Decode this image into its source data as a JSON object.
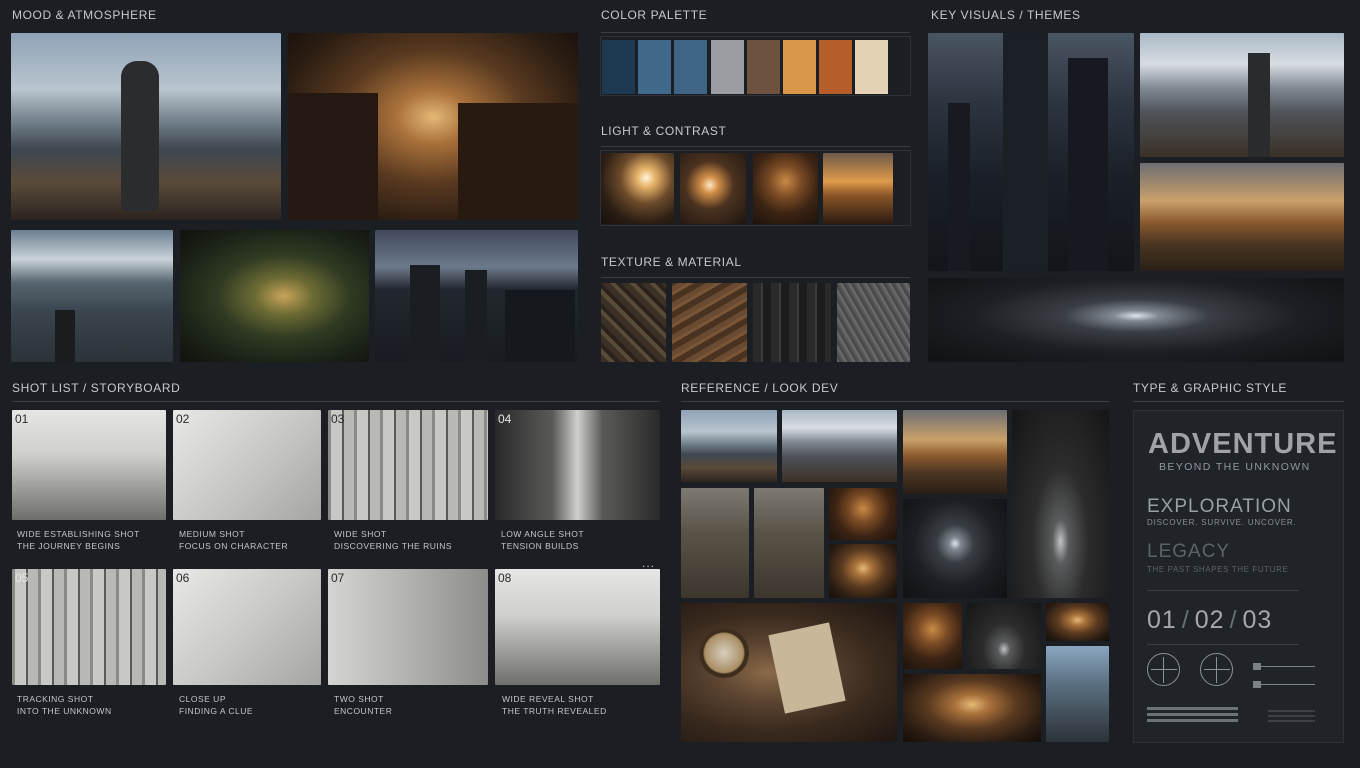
{
  "sections": {
    "mood": "MOOD & ATMOSPHERE",
    "palette": "COLOR PALETTE",
    "light": "LIGHT & CONTRAST",
    "texture": "TEXTURE & MATERIAL",
    "key_visuals": "KEY VISUALS / THEMES",
    "shot_list": "SHOT LIST / STORYBOARD",
    "reference": "REFERENCE / LOOK DEV",
    "type": "TYPE & GRAPHIC STYLE"
  },
  "palette": [
    "#1d3a52",
    "#3f6a8c",
    "#3f6585",
    "#9a9da1",
    "#6e5240",
    "#d9974a",
    "#b65e2a",
    "#e3d3b4"
  ],
  "shots": [
    {
      "num": "01",
      "line1": "WIDE ESTABLISHING SHOT",
      "line2": "THE JOURNEY BEGINS"
    },
    {
      "num": "02",
      "line1": "MEDIUM SHOT",
      "line2": "FOCUS ON CHARACTER"
    },
    {
      "num": "03",
      "line1": "WIDE SHOT",
      "line2": "DISCOVERING THE RUINS"
    },
    {
      "num": "04",
      "line1": "LOW ANGLE SHOT",
      "line2": "TENSION BUILDS"
    },
    {
      "num": "05",
      "line1": "TRACKING SHOT",
      "line2": "INTO THE UNKNOWN"
    },
    {
      "num": "06",
      "line1": "CLOSE UP",
      "line2": "FINDING A CLUE"
    },
    {
      "num": "07",
      "line1": "TWO SHOT",
      "line2": "ENCOUNTER"
    },
    {
      "num": "08",
      "line1": "WIDE REVEAL SHOT",
      "line2": "THE TRUTH REVEALED"
    }
  ],
  "more": "...",
  "type_style": {
    "title": "ADVENTURE",
    "title_sub": "BEYOND THE UNKNOWN",
    "exploration": "EXPLORATION",
    "exploration_sub": "DISCOVER. SURVIVE. UNCOVER.",
    "legacy": "LEGACY",
    "legacy_sub": "THE PAST SHAPES THE FUTURE",
    "n1": "01",
    "n2": "02",
    "n3": "03",
    "sep": "/"
  }
}
